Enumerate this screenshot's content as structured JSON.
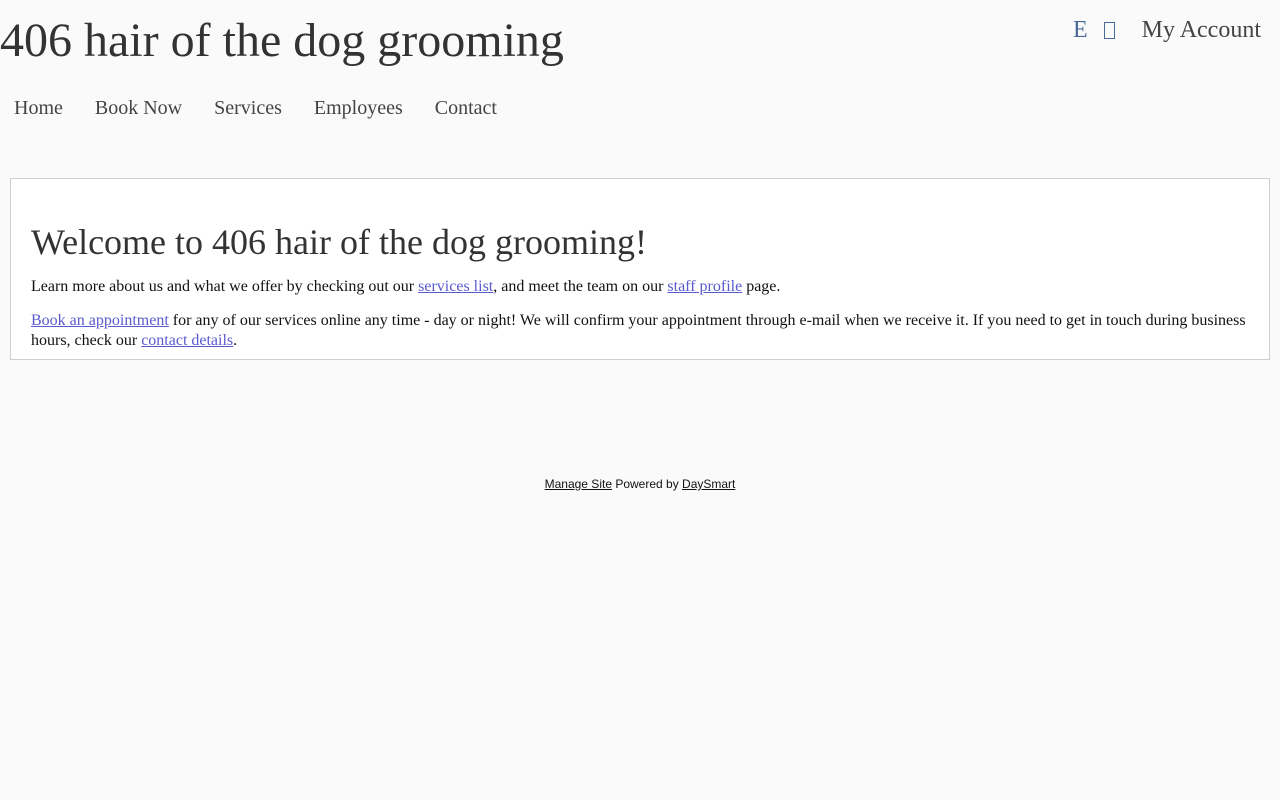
{
  "header": {
    "site_title": "406 hair of the dog grooming",
    "icon_e_glyph": "E",
    "my_account": "My Account"
  },
  "nav": {
    "items": [
      {
        "label": "Home"
      },
      {
        "label": "Book Now"
      },
      {
        "label": "Services"
      },
      {
        "label": "Employees"
      },
      {
        "label": "Contact"
      }
    ]
  },
  "main": {
    "heading": "Welcome to 406 hair of the dog grooming!",
    "p1": {
      "before": "Learn more about us and what we offer by checking out our ",
      "link1": "services list",
      "middle": ", and meet the team on our ",
      "link2": "staff profile",
      "after": " page."
    },
    "p2": {
      "link1": "Book an appointment",
      "middle": " for any of our services online any time - day or night! We will confirm your appointment through e-mail when we receive it. If you need to get in touch during business hours, check our ",
      "link2": "contact details",
      "after": "."
    }
  },
  "footer": {
    "manage_site": "Manage Site",
    "powered_by": " Powered by ",
    "daysmart": "DaySmart"
  },
  "colors": {
    "background": "#fafafa",
    "link": "#5a5acf",
    "icon": "#4a6a9a"
  }
}
